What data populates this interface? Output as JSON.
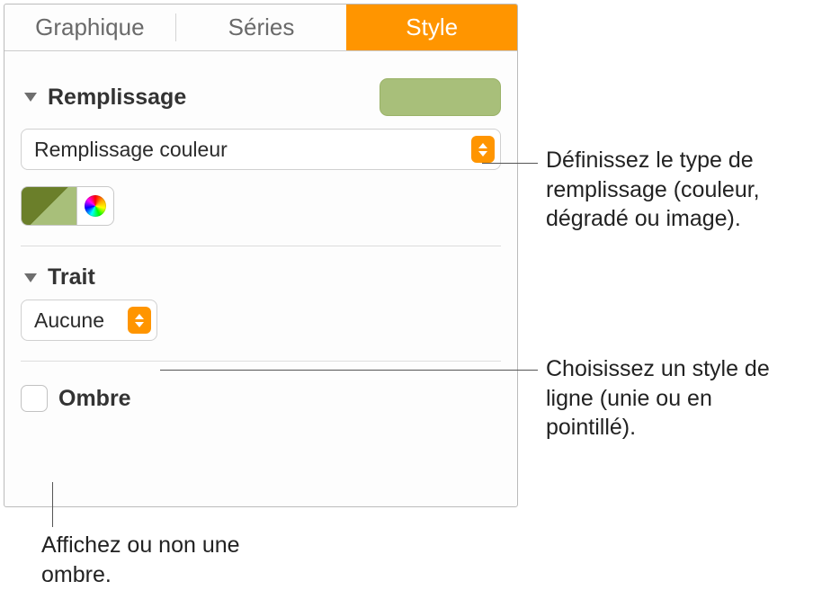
{
  "tabs": {
    "graphique": "Graphique",
    "series": "Séries",
    "style": "Style"
  },
  "sections": {
    "remplissage": {
      "title": "Remplissage",
      "popup": "Remplissage couleur"
    },
    "trait": {
      "title": "Trait",
      "popup": "Aucune"
    },
    "ombre": {
      "label": "Ombre"
    }
  },
  "callouts": {
    "fill": "Définissez le type de remplissage (couleur, dégradé ou image).",
    "line": "Choisissez un style de ligne (unie ou en pointillé).",
    "shadow": "Affichez ou non une ombre."
  }
}
